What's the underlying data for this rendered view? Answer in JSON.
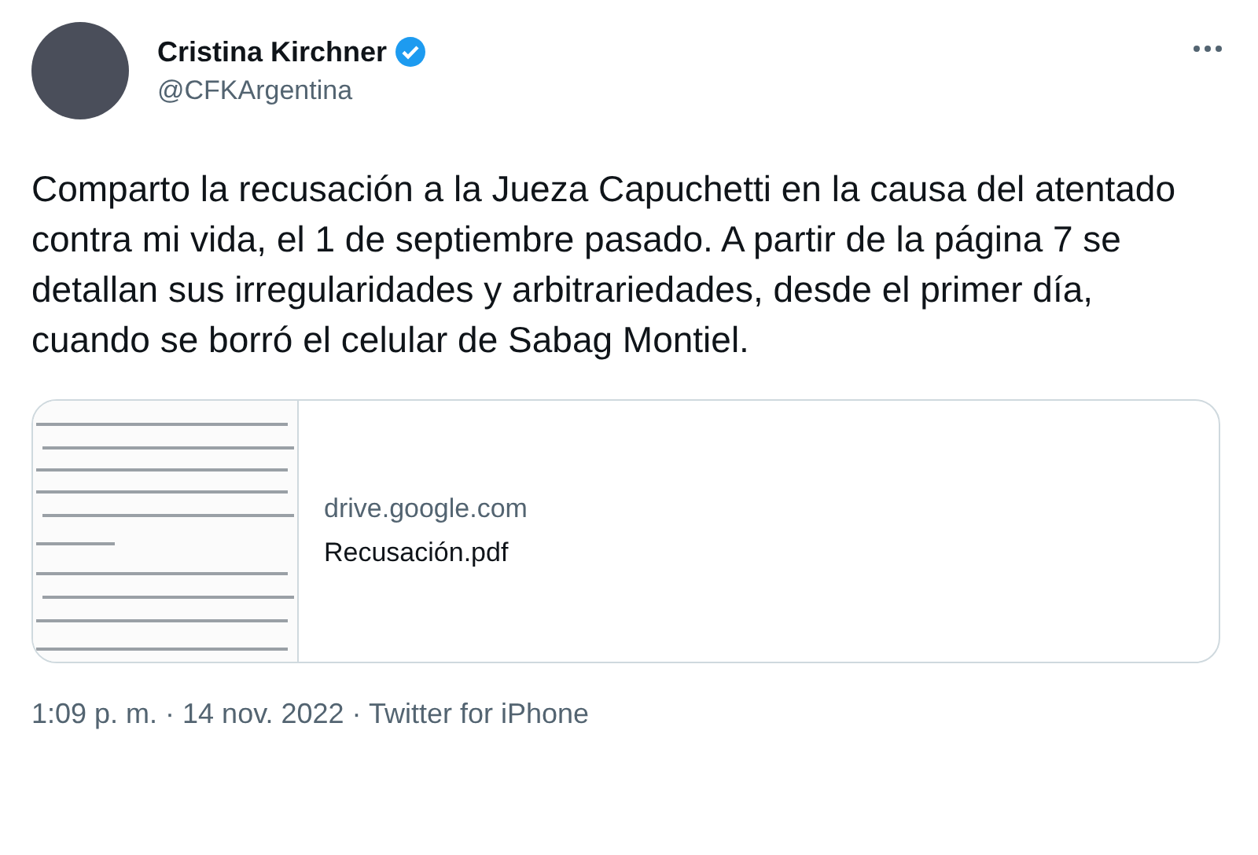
{
  "author": {
    "name": "Cristina Kirchner",
    "verified": true,
    "handle": "@CFKArgentina"
  },
  "text": "Comparto la recusación a la Jueza Capuchetti en la causa del atentado contra mi vida, el 1 de septiembre pasado. A partir de la página 7 se detallan sus irregularidades y arbitrariedades, desde el primer día, cuando se borró el celular de Sabag Montiel.",
  "link_card": {
    "domain": "drive.google.com",
    "title": "Recusación.pdf"
  },
  "meta": "1:09 p. m. · 14 nov. 2022 · Twitter for iPhone"
}
